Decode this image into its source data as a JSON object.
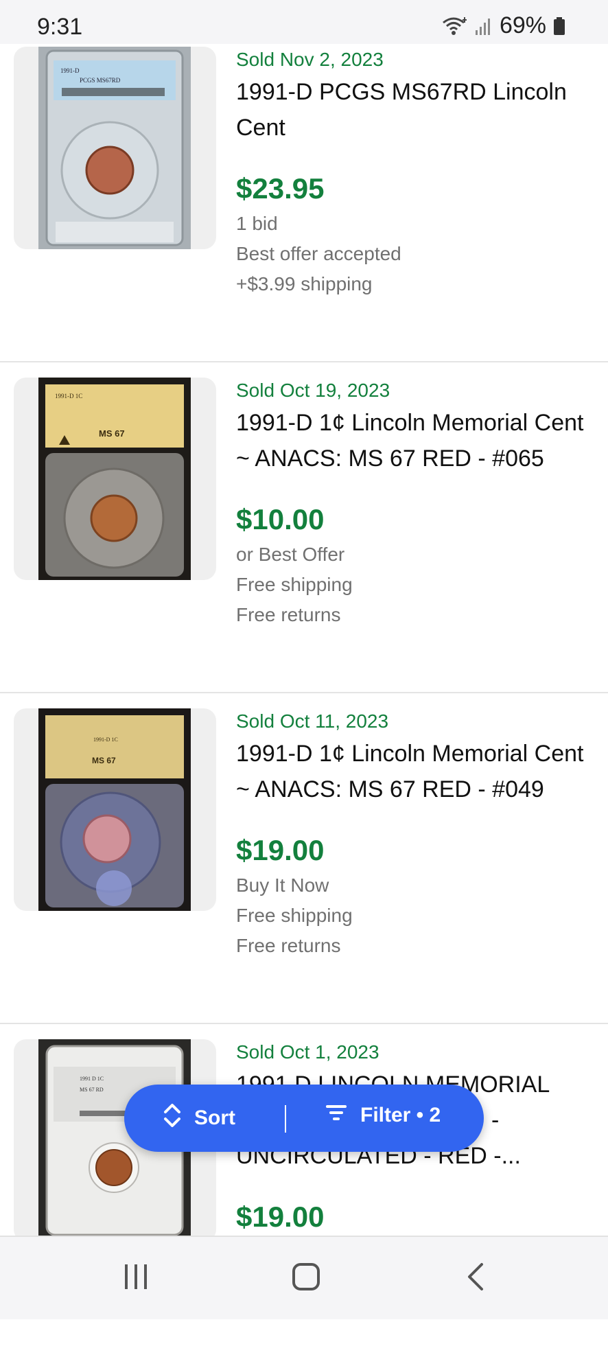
{
  "status": {
    "time": "9:31",
    "battery": "69%"
  },
  "listings": [
    {
      "sold": "Sold Nov 2, 2023",
      "title_lines": [
        "1991-D PCGS MS67RD Lincoln",
        "Cent"
      ],
      "price": "$23.95",
      "details": [
        "1 bid",
        "Best offer accepted",
        "+$3.99 shipping"
      ],
      "slab_label": [
        "1991-D",
        "PCGS MS67RD"
      ]
    },
    {
      "sold": "Sold Oct 19, 2023",
      "title_lines": [
        "1991-D 1¢ Lincoln Memorial Cent",
        "~ ANACS: MS 67 RED - #065"
      ],
      "price": "$10.00",
      "details": [
        "or Best Offer",
        "Free shipping",
        "Free returns"
      ],
      "slab_label": [
        "1991-D 1C",
        "MS 67"
      ]
    },
    {
      "sold": "Sold Oct 11, 2023",
      "title_lines": [
        "1991-D 1¢ Lincoln Memorial Cent",
        "~ ANACS: MS 67 RED - #049"
      ],
      "price": "$19.00",
      "details": [
        "Buy It Now",
        "Free shipping",
        "Free returns"
      ],
      "slab_label": [
        "1991-D 1C",
        "MS 67"
      ]
    },
    {
      "sold": "Sold Oct 1, 2023",
      "title_lines": [
        "1991 D LINCOLN MEMORIAL",
        "-",
        "UNCIRCULATED - RED -..."
      ],
      "price": "$19.00",
      "details": [],
      "slab_label": [
        "1991 D 1C",
        "MS 67 RD"
      ]
    }
  ],
  "sortbar": {
    "sort_label": "Sort",
    "filter_label": "Filter • 2"
  },
  "icons": {
    "wifi": "wifi-icon",
    "signal": "signal-icon",
    "battery": "battery-icon",
    "sort": "sort-updown-icon",
    "filter": "filter-lines-icon",
    "recents": "recents-icon",
    "home": "home-icon",
    "back": "back-icon"
  },
  "colors": {
    "sold_green": "#13803d",
    "accent_blue": "#3265f0"
  }
}
